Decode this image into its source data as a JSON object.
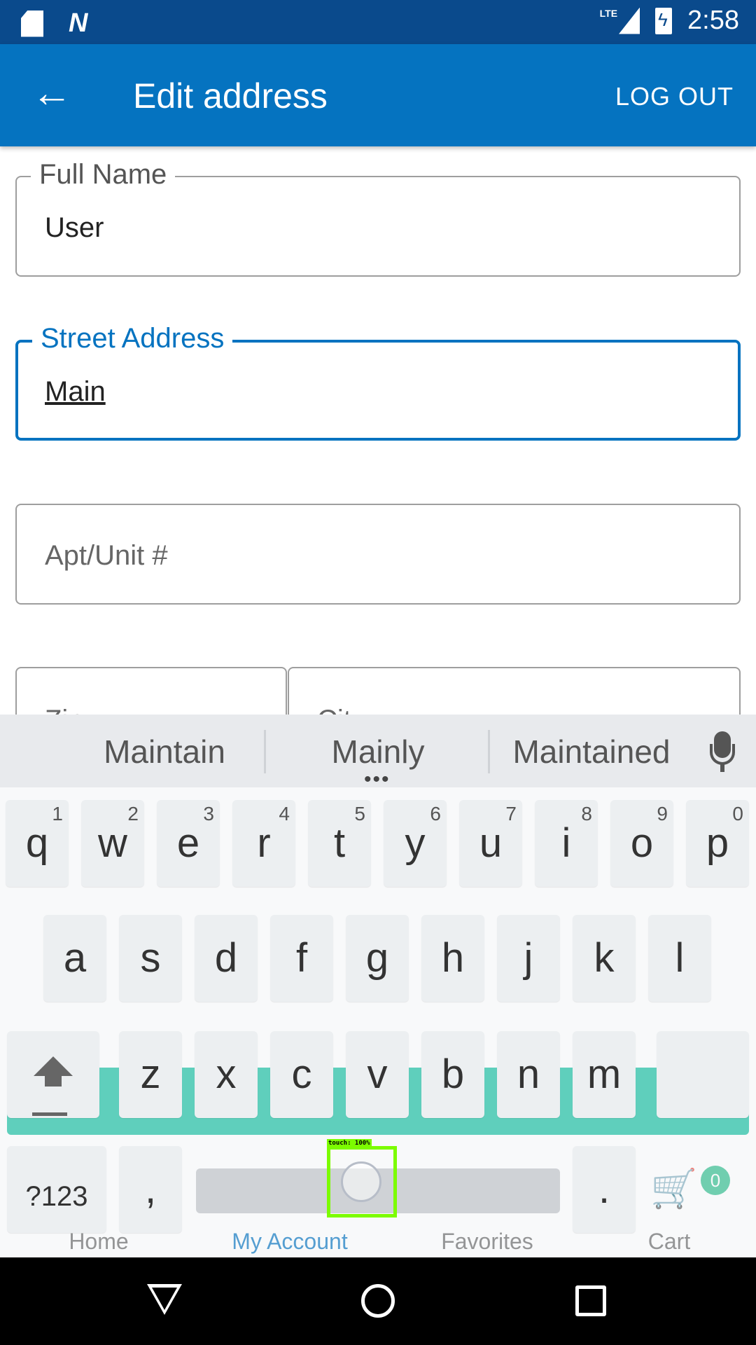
{
  "status_bar": {
    "time": "2:58",
    "network": "LTE",
    "icons": [
      "sd-card-icon",
      "n-notification-icon",
      "signal-icon",
      "battery-charging-icon"
    ]
  },
  "app_bar": {
    "title": "Edit address",
    "logout_label": "LOG OUT",
    "back_icon": "arrow-back-icon"
  },
  "form": {
    "full_name": {
      "label": "Full Name",
      "value": "User"
    },
    "street_address": {
      "label": "Street Address",
      "value": "Main"
    },
    "apt_unit": {
      "placeholder": "Apt/Unit #"
    },
    "zip": {
      "label": "Zip"
    },
    "city": {
      "label": "City"
    }
  },
  "bottom_nav": {
    "items": [
      {
        "label": "Home",
        "icon": "home-icon"
      },
      {
        "label": "My Account",
        "icon": "account-icon",
        "active": true
      },
      {
        "label": "Favorites",
        "icon": "heart-icon"
      },
      {
        "label": "Cart",
        "icon": "cart-icon",
        "badge": "0"
      }
    ]
  },
  "keyboard": {
    "suggestions": [
      "Maintain",
      "Mainly",
      "Maintained"
    ],
    "row1": [
      {
        "key": "q",
        "hint": "1"
      },
      {
        "key": "w",
        "hint": "2"
      },
      {
        "key": "e",
        "hint": "3"
      },
      {
        "key": "r",
        "hint": "4"
      },
      {
        "key": "t",
        "hint": "5"
      },
      {
        "key": "y",
        "hint": "6"
      },
      {
        "key": "u",
        "hint": "7"
      },
      {
        "key": "i",
        "hint": "8"
      },
      {
        "key": "o",
        "hint": "9"
      },
      {
        "key": "p",
        "hint": "0"
      }
    ],
    "row2": [
      "a",
      "s",
      "d",
      "f",
      "g",
      "h",
      "j",
      "k",
      "l"
    ],
    "row3": [
      "z",
      "x",
      "c",
      "v",
      "b",
      "n",
      "m"
    ],
    "symbols_label": "?123",
    "comma_label": ",",
    "period_label": "."
  },
  "touch_overlay": {
    "label": "touch: 100%"
  },
  "colors": {
    "status_bar": "#0a4a8c",
    "app_bar": "#0573c0",
    "accent": "#0573c0",
    "button_behind": "#14bfa0",
    "badge": "#2ebd8c"
  }
}
